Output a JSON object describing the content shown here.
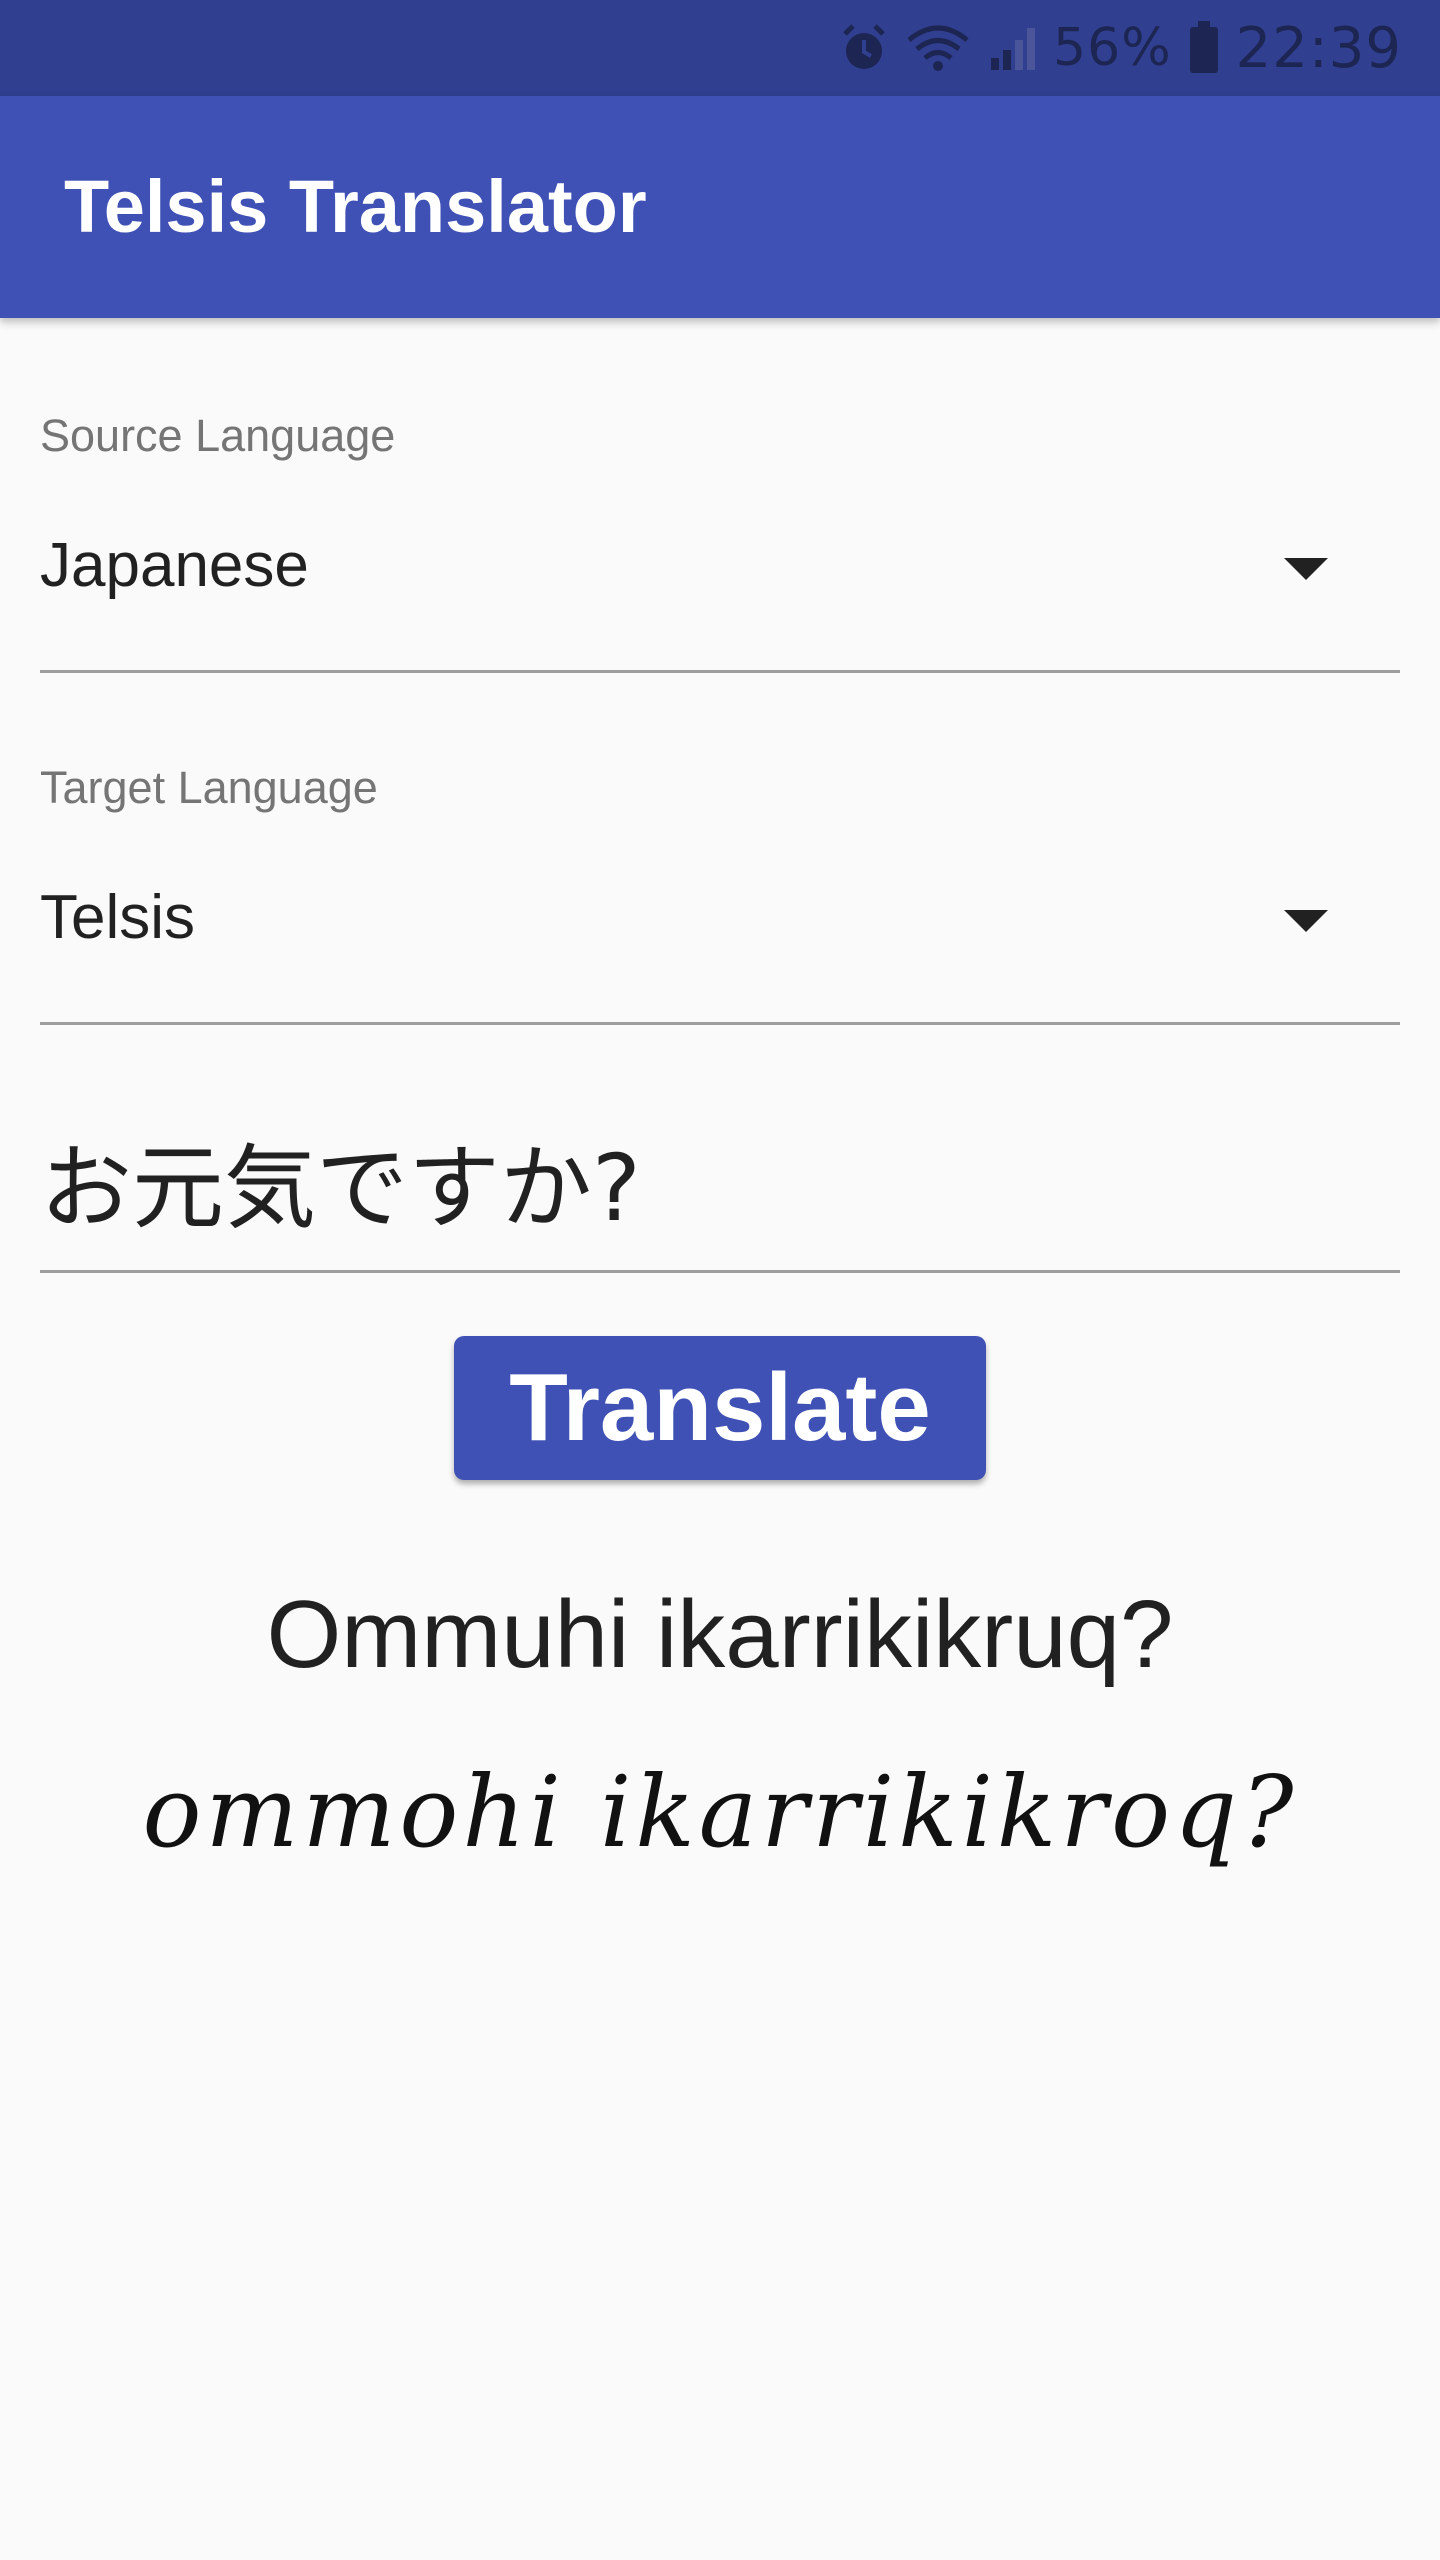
{
  "status_bar": {
    "battery_percent": "56%",
    "time": "22:39",
    "icons": [
      "alarm-icon",
      "wifi-icon",
      "signal-icon",
      "battery-icon"
    ]
  },
  "app_bar": {
    "title": "Telsis Translator",
    "color": "#3f51b5"
  },
  "source": {
    "label": "Source Language",
    "value": "Japanese"
  },
  "target": {
    "label": "Target Language",
    "value": "Telsis"
  },
  "input": {
    "value": "お元気ですか?"
  },
  "button": {
    "label": "Translate"
  },
  "result": {
    "text": "Ommuhi ikarrikikruq?",
    "script": "ommohi ikarrikikroq?"
  }
}
